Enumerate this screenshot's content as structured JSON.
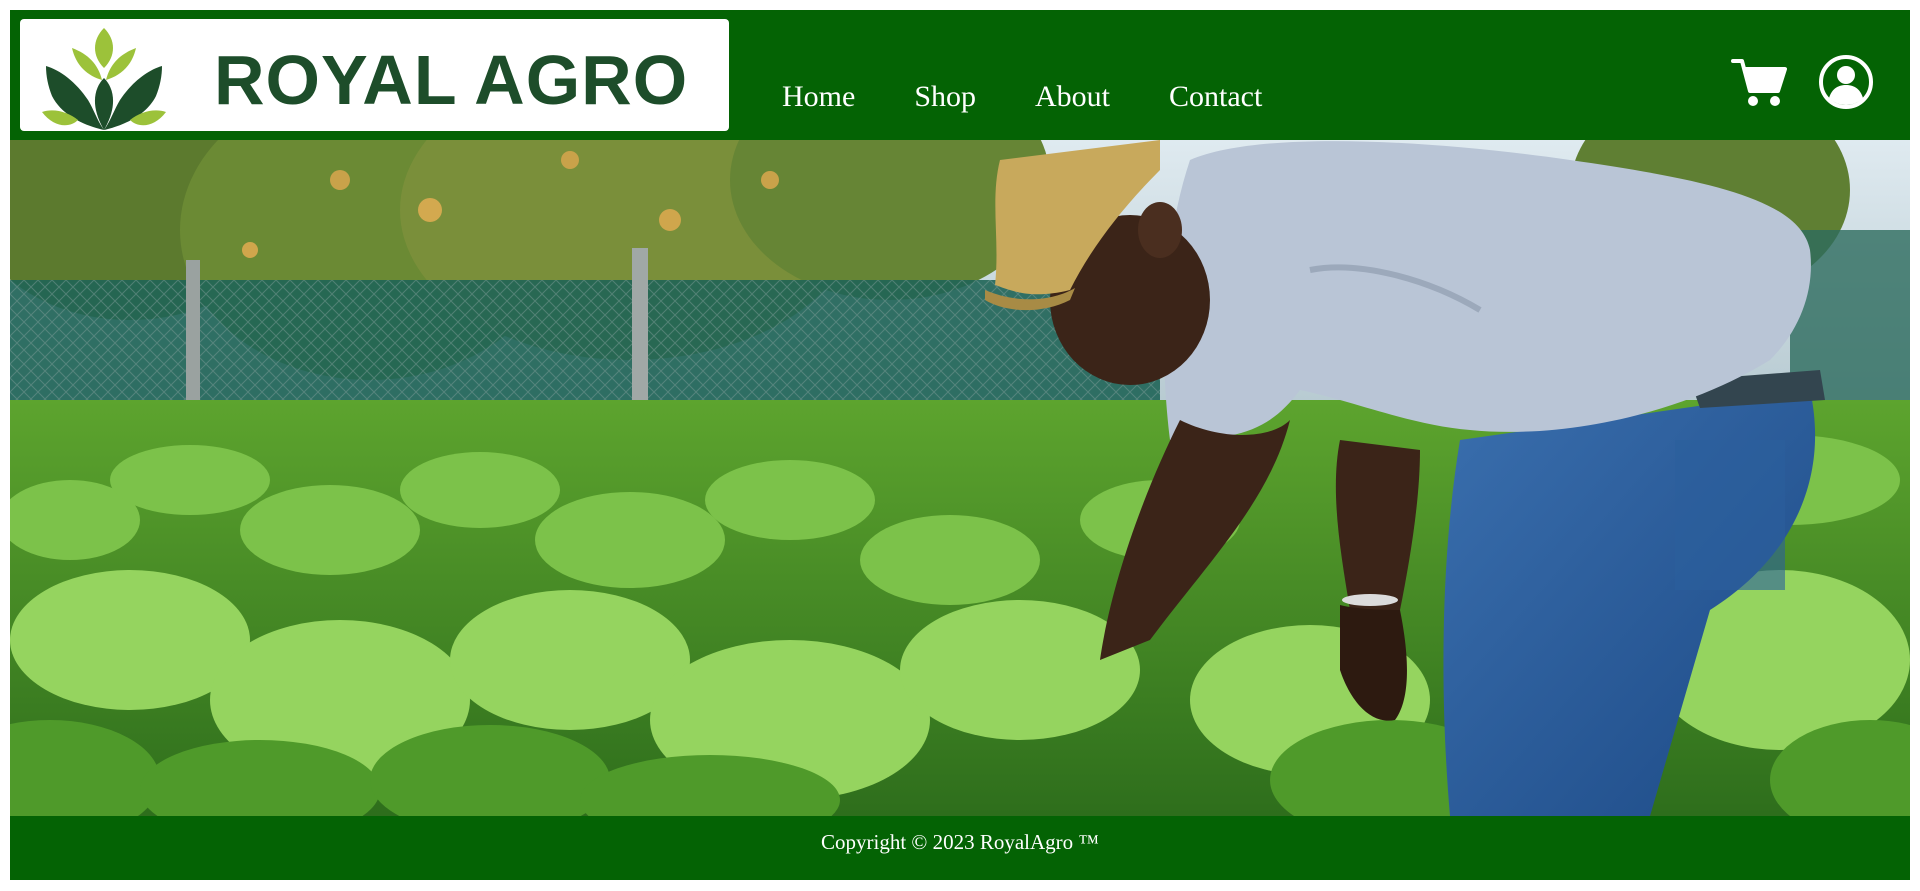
{
  "brand": {
    "name": "ROYAL AGRO",
    "logo_icon": "leaf-sprout-icon"
  },
  "nav": {
    "items": [
      {
        "label": "Home"
      },
      {
        "label": "Shop"
      },
      {
        "label": "About"
      },
      {
        "label": "Contact"
      }
    ]
  },
  "header_icons": {
    "cart": "cart-icon",
    "account": "account-icon"
  },
  "hero": {
    "image": "farmer-tending-leafy-crops-photo"
  },
  "footer": {
    "copyright": "Copyright © 2023 RoyalAgro ™"
  },
  "colors": {
    "header_bg": "#046304",
    "footer_bg": "#046304",
    "logo_text": "#1d4d2a",
    "logo_leaf_light": "#9cc23a",
    "logo_leaf_dark": "#1d4d2a",
    "nav_text": "#ffffff"
  }
}
